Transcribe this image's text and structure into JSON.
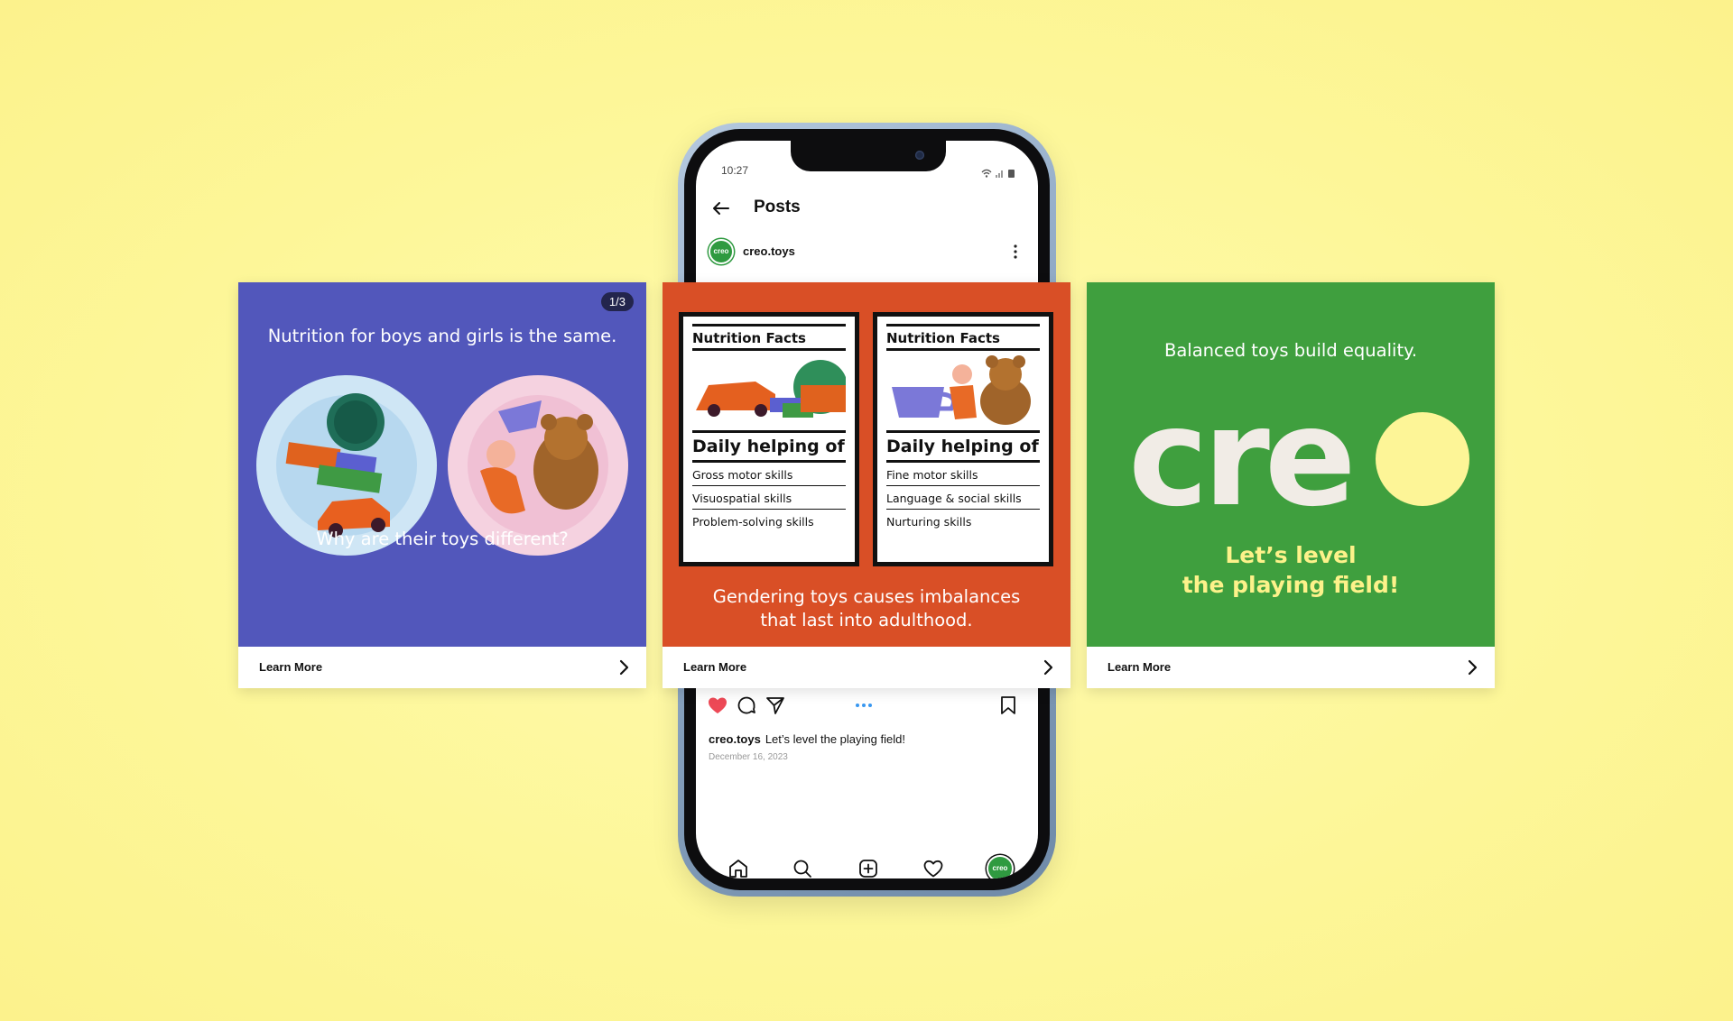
{
  "phone": {
    "status_time": "10:27",
    "title": "Posts",
    "account": "creo.toys",
    "avatar_text": "creo",
    "caption_user": "creo.toys",
    "caption_text": "Let’s level the playing field!",
    "date": "December 16, 2023"
  },
  "cards": {
    "card1": {
      "counter": "1/3",
      "top_text": "Nutrition for boys and girls is the same.",
      "bottom_text": "Why are their toys different?",
      "cta": "Learn More"
    },
    "card2": {
      "panel_left": {
        "title": "Nutrition Facts",
        "daily": "Daily helping of",
        "items": [
          "Gross motor skills",
          "Visuospatial skills",
          "Problem-solving skills"
        ]
      },
      "panel_right": {
        "title": "Nutrition Facts",
        "daily": "Daily helping of",
        "items": [
          "Fine motor skills",
          "Language & social skills",
          "Nurturing skills"
        ]
      },
      "bottom_line1": "Gendering toys causes imbalances",
      "bottom_line2": "that last into adulthood.",
      "cta": "Learn More"
    },
    "card3": {
      "top_text": "Balanced toys build equality.",
      "logo": "cre",
      "line1": "Let’s level",
      "line2": "the playing field!",
      "cta": "Learn More"
    }
  },
  "colors": {
    "background": "#fdf79a",
    "card1_bg": "#5257bb",
    "card2_bg": "#d94f26",
    "card3_bg": "#3f9f3e",
    "brand_green": "#2f9a40",
    "accent_yellow": "#fdf28a",
    "like_red": "#ed4956"
  },
  "icons": {
    "back": "arrow-left-icon",
    "more": "more-vertical-icon",
    "like": "heart-filled-icon",
    "comment": "comment-icon",
    "share": "paper-plane-icon",
    "save": "bookmark-icon",
    "home": "home-icon",
    "search": "search-icon",
    "create": "plus-square-icon",
    "activity": "heart-icon",
    "next": "chevron-right-icon"
  }
}
